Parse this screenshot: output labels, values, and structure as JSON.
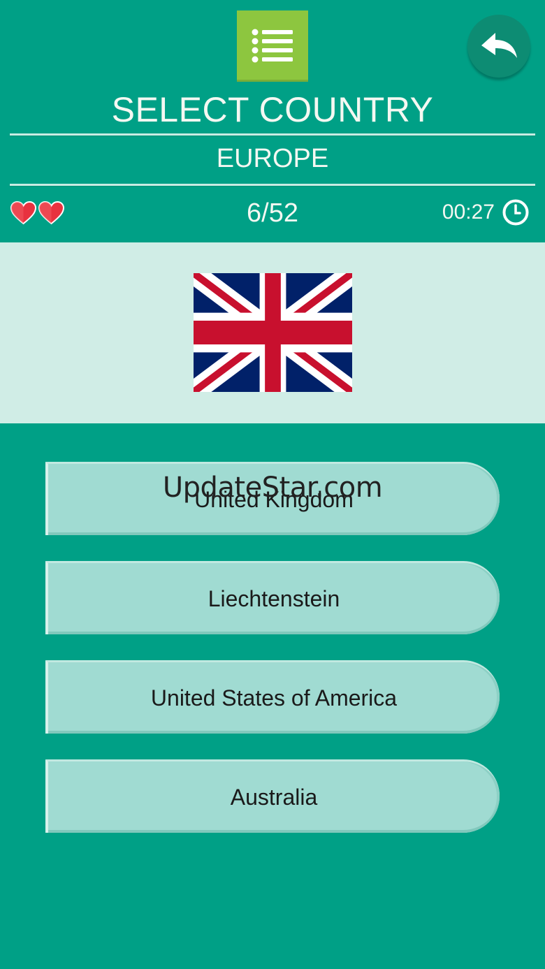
{
  "header": {
    "title": "SELECT COUNTRY",
    "region": "EUROPE",
    "menu_icon": "list-menu-icon",
    "back_icon": "back-arrow-icon"
  },
  "status": {
    "lives": 2,
    "life_icon": "heart-icon",
    "progress": "6/52",
    "timer": "00:27",
    "timer_icon": "clock-icon"
  },
  "question": {
    "flag": "united-kingdom-flag"
  },
  "answers": [
    {
      "label": "United Kingdom"
    },
    {
      "label": "Liechtenstein"
    },
    {
      "label": "United States of America"
    },
    {
      "label": "Australia"
    }
  ],
  "watermark": "UpdateStar.com",
  "colors": {
    "background": "#00a086",
    "menu_button": "#8dc63f",
    "back_button": "#0d8c73",
    "flag_panel": "#d0ede6",
    "answer_button": "#a0dbd2",
    "heart": "#e8323f"
  }
}
